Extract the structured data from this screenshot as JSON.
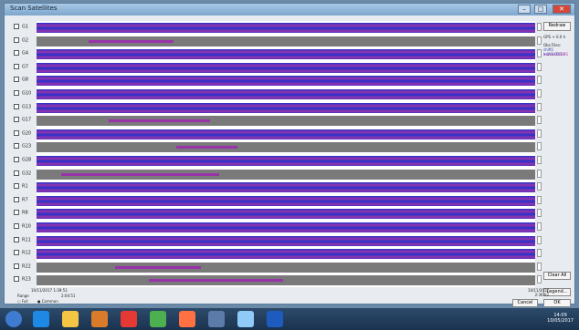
{
  "window": {
    "title": "Scan Satellites"
  },
  "rows": [
    "G1",
    "G2",
    "G4",
    "G7",
    "G8",
    "G10",
    "G13",
    "G17",
    "G20",
    "G23",
    "G28",
    "G32",
    "R1",
    "R7",
    "R8",
    "R10",
    "R11",
    "R12",
    "R22",
    "R23"
  ],
  "checked": [
    true,
    false,
    true,
    true,
    true,
    true,
    true,
    false,
    true,
    false,
    true,
    false,
    true,
    true,
    true,
    true,
    true,
    true,
    false,
    false
  ],
  "right_panel": {
    "redraw": "Redraw",
    "gps_label": "GPS + 0.0 h",
    "obs_files": "Obs Files:",
    "file1": "shift1 +005.DBS",
    "file2": "bur-wel1.DBS",
    "clear_all": "Clear All",
    "legend": "Legend...",
    "ok": "OK",
    "cancel": "Cancel"
  },
  "time_axis": {
    "start": "10/11/2017 1:39:51",
    "mid": "2:04:51",
    "end": "10/11/2017 2:36:02"
  },
  "range": {
    "label": "Range",
    "full": "Full",
    "common": "Common"
  },
  "taskbar": {
    "time": "14:09",
    "date": "10/05/2017"
  },
  "colors": {
    "blue": "#2233cc",
    "purple": "#9933aa",
    "gray": "#7a7a7a",
    "pink": "#cc3399"
  }
}
